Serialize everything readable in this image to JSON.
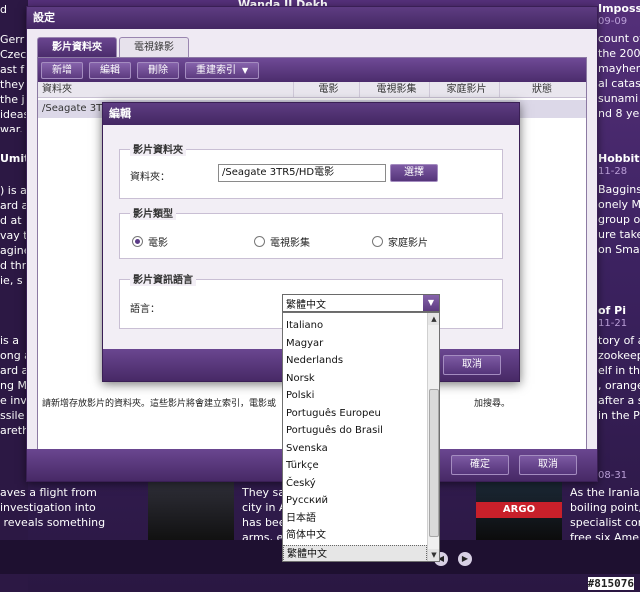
{
  "background": {
    "left_text": "d\n\nGerr\nCzec\nast f\nthey\nthe j\nideas\nwar.",
    "left_head": "Umit",
    "left_text2": ") is a\nard a\nd at\nvay t\nagine\nd thr\nie, s",
    "left_text3": "is a\nong a\nard are\nng M\ne invol\nssile\narethe",
    "mid_top_title": "Wanda II Dekh",
    "right_top_title": "Imposs",
    "right_top_date": "09-09",
    "right_text1": "count of\nthe 2004\nmayhem o\nal catast\nsunami in\nnd 8 yea",
    "right_head2": "Hobbit:",
    "right_date2": "11-28",
    "right_text2": "Baggins\nonely Mo\ngroup of\nure take\non Smaug",
    "right_head3": "of Pi",
    "right_date3": "11-21",
    "right_text3": "tory of a\nzookeep\nelf in the\n, orange\nafter a s\nin the Pa",
    "right_date4": "08-31",
    "right_text4": "As the Iranian\nboiling point, \nspecialist con\nfree six Americ",
    "bottom_left_text": "aves a flight from\ninvestigation into\n reveals something",
    "bottom_mid_text": "They sa\ncity in A\nhas bee\narms, e",
    "poster_argo": "ARGO",
    "watermark": "#815076"
  },
  "settings": {
    "title": "設定",
    "tabs": [
      {
        "label": "影片資料夾",
        "active": true
      },
      {
        "label": "電視錄影",
        "active": false
      }
    ],
    "toolbar": {
      "add": "新增",
      "edit": "編輯",
      "delete": "刪除",
      "reindex": "重建索引"
    },
    "columns": [
      "資料夾",
      "電影",
      "電視影集",
      "家庭影片",
      "狀態"
    ],
    "row_folder": "/Seagate 3TR5",
    "hint": "請新增存放影片的資料夾。這些影片將會建立索引，電影或",
    "hint_tail": "加搜尋。",
    "ok": "確定",
    "cancel": "取消"
  },
  "edit_dialog": {
    "title": "編輯",
    "folder_group": "影片資料夾",
    "folder_label": "資料夾：",
    "folder_value": "/Seagate 3TR5/HD電影",
    "browse": "選擇",
    "type_group": "影片類型",
    "types": [
      {
        "label": "電影",
        "selected": true
      },
      {
        "label": "電視影集",
        "selected": false
      },
      {
        "label": "家庭影片",
        "selected": false
      }
    ],
    "lang_group": "影片資訊語言",
    "lang_label": "語言：",
    "lang_value": "繁體中文",
    "cancel": "取消"
  },
  "language_options": [
    "Italiano",
    "Magyar",
    "Nederlands",
    "Norsk",
    "Polski",
    "Português Europeu",
    "Português do Brasil",
    "Svenska",
    "Türkçe",
    "Český",
    "Русский",
    "日本語",
    "简体中文",
    "繁體中文"
  ],
  "selected_language": "繁體中文"
}
